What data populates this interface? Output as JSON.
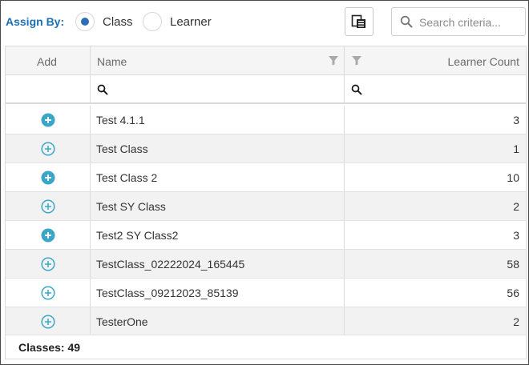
{
  "toolbar": {
    "assign_label": "Assign By:",
    "options": [
      {
        "label": "Class",
        "selected": true
      },
      {
        "label": "Learner",
        "selected": false
      }
    ],
    "search_placeholder": "Search criteria..."
  },
  "grid": {
    "columns": [
      "Add",
      "Name",
      "Learner Count"
    ],
    "rows": [
      {
        "name": "Test 4.1.1",
        "count": "3",
        "added": true
      },
      {
        "name": "Test Class",
        "count": "1",
        "added": false
      },
      {
        "name": "Test Class 2",
        "count": "10",
        "added": true
      },
      {
        "name": "Test SY Class",
        "count": "2",
        "added": false
      },
      {
        "name": "Test2 SY Class2",
        "count": "3",
        "added": true
      },
      {
        "name": "TestClass_02222024_165445",
        "count": "58",
        "added": false
      },
      {
        "name": "TestClass_09212023_85139",
        "count": "56",
        "added": false
      },
      {
        "name": "TesterOne",
        "count": "2",
        "added": false
      }
    ],
    "footer": "Classes: 49"
  },
  "colors": {
    "accent": "#2e6db4",
    "add_icon": "#3aa6c9",
    "label_blue": "#1e6fb3"
  }
}
